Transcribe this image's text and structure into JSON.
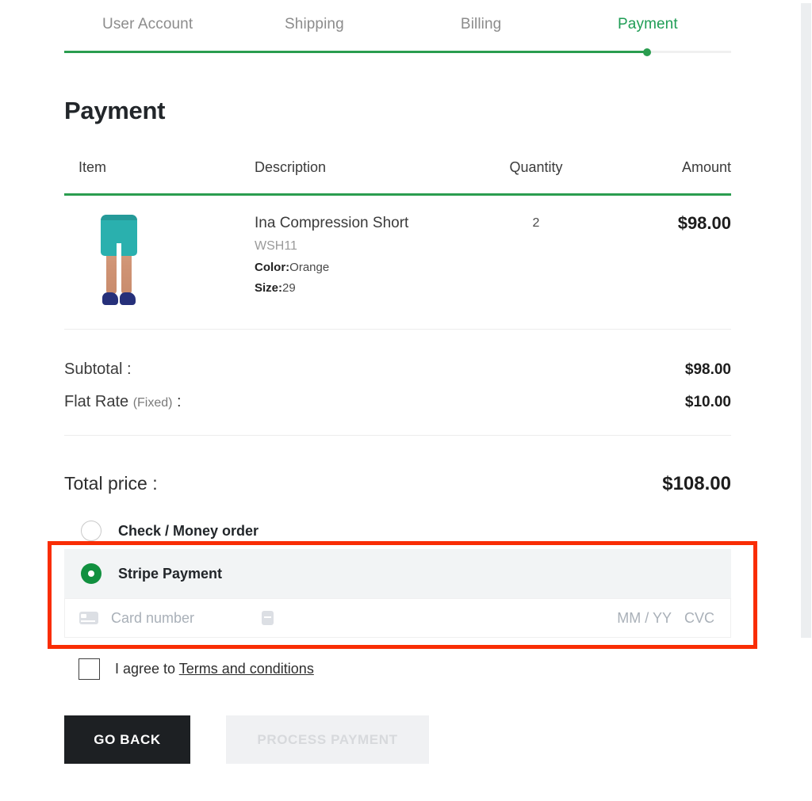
{
  "steps": {
    "items": [
      {
        "label": "User Account",
        "active": false
      },
      {
        "label": "Shipping",
        "active": false
      },
      {
        "label": "Billing",
        "active": false
      },
      {
        "label": "Payment",
        "active": true
      }
    ],
    "active_color": "#1f9d55",
    "track_color": "#2a9d4f",
    "progress_percent": 87.5
  },
  "page": {
    "title": "Payment"
  },
  "order_table": {
    "headers": {
      "item": "Item",
      "description": "Description",
      "quantity": "Quantity",
      "amount": "Amount"
    },
    "rows": [
      {
        "image_name": "ina-compression-short-thumbnail",
        "name": "Ina Compression Short",
        "sku": "WSH11",
        "options": [
          {
            "label": "Color:",
            "value": "Orange"
          },
          {
            "label": "Size:",
            "value": "29"
          }
        ],
        "quantity": "2",
        "amount": "$98.00"
      }
    ]
  },
  "totals": {
    "lines": [
      {
        "label": "Subtotal :",
        "sub_label": "",
        "value": "$98.00"
      },
      {
        "label": "Flat Rate ",
        "sub_label": "(Fixed)",
        "suffix": " :",
        "value": "$10.00"
      }
    ],
    "grand": {
      "label": "Total price :",
      "value": "$108.00"
    }
  },
  "payment_methods": {
    "options": [
      {
        "id": "checkmo",
        "label": "Check / Money order",
        "selected": false
      },
      {
        "id": "stripe",
        "label": "Stripe Payment",
        "selected": true
      }
    ],
    "selected_color": "#11903f"
  },
  "card_form": {
    "card_icon": "credit-card-icon",
    "card_number_placeholder": "Card number",
    "brand_icon": "card-brand-icon",
    "expiry_placeholder": "MM / YY",
    "cvc_placeholder": "CVC",
    "card_number_value": "",
    "expiry_value": "",
    "cvc_value": ""
  },
  "highlight": {
    "color": "#f92d05"
  },
  "terms": {
    "checked": false,
    "text_prefix": "I agree to ",
    "link_label": "Terms and conditions"
  },
  "actions": {
    "back_label": "GO BACK",
    "process_label": "PROCESS PAYMENT",
    "process_disabled": true
  }
}
